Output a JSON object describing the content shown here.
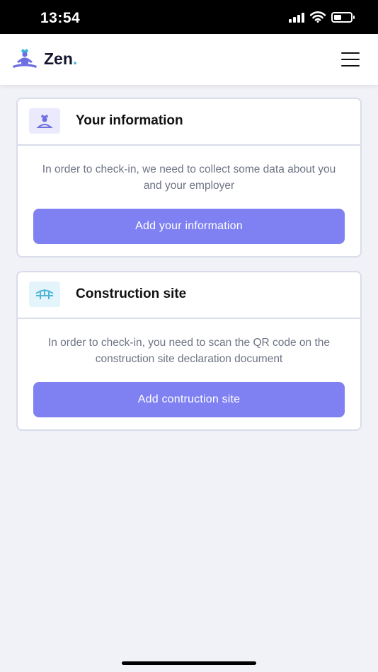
{
  "status_bar": {
    "time": "13:54",
    "battery_level": 0.45
  },
  "header": {
    "logo_text": "Zen",
    "logo_dot": ".",
    "logo_icon": "meditation-icon",
    "menu_icon": "hamburger-menu-icon"
  },
  "cards": {
    "info": {
      "title": "Your information",
      "description": "In order to check-in, we need to collect some data about you and your employer",
      "button_label": "Add your information",
      "icon": "worker-icon"
    },
    "site": {
      "title": "Construction site",
      "description": "In order to check-in, you need to scan the QR code on the construction site declaration document",
      "button_label": "Add contruction site",
      "icon": "bridge-icon"
    }
  },
  "colors": {
    "accent": "#7f81f3",
    "logo_dot": "#3fb8d8",
    "background": "#f1f2f7",
    "border": "#d9dcea",
    "text_muted": "#6e7485"
  }
}
